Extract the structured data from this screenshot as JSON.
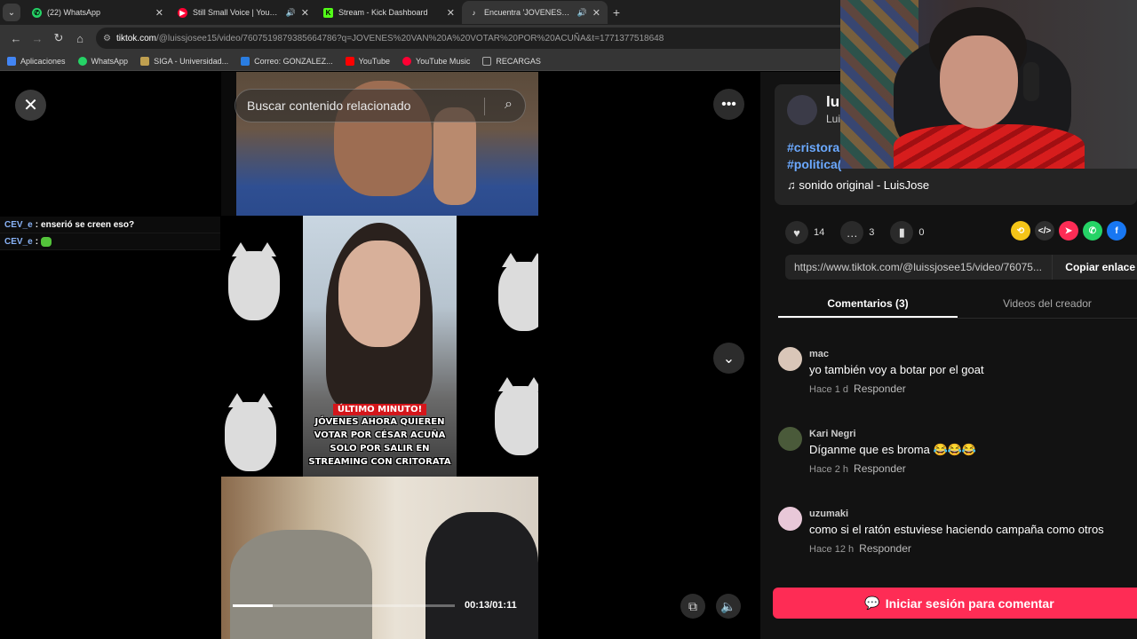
{
  "browser": {
    "tabs": [
      {
        "title": "(22) WhatsApp",
        "icon": "whatsapp-icon",
        "color": "#25d366",
        "audio": false
      },
      {
        "title": "Still Small Voice | YouTube M",
        "icon": "youtube-music-icon",
        "color": "#ff0033",
        "audio": true
      },
      {
        "title": "Stream - Kick Dashboard",
        "icon": "kick-icon",
        "color": "#53fc18",
        "audio": false
      },
      {
        "title": "Encuentra 'JOVENES VAN A",
        "icon": "tiktok-icon",
        "color": "#ffffff",
        "audio": true
      }
    ],
    "url_host": "tiktok.com",
    "url_rest": "/@luissjosee15/video/7607519879385664786?q=JOVENES%20VAN%20A%20VOTAR%20POR%20ACUÑA&t=1771377518648",
    "bookmarks": [
      {
        "label": "Aplicaciones",
        "icon": "apps-grid-icon",
        "color": "#4285f4"
      },
      {
        "label": "WhatsApp",
        "icon": "whatsapp-icon",
        "color": "#25d366"
      },
      {
        "label": "SIGA - Universidad...",
        "icon": "siga-icon",
        "color": "#c0a050"
      },
      {
        "label": "Correo: GONZALEZ...",
        "icon": "mail-icon",
        "color": "#2a7de1"
      },
      {
        "label": "YouTube",
        "icon": "youtube-icon",
        "color": "#ff0000"
      },
      {
        "label": "YouTube Music",
        "icon": "youtube-music-icon",
        "color": "#ff0033"
      },
      {
        "label": "RECARGAS",
        "icon": "folder-icon",
        "color": "#aaaaaa"
      }
    ]
  },
  "chat": [
    {
      "user": "CEV_e",
      "message": "enserió se creen eso?",
      "emote": false
    },
    {
      "user": "CEV_e",
      "message": "",
      "emote": true
    }
  ],
  "video": {
    "search_placeholder": "Buscar contenido relacionado",
    "headline_tag": "ÚLTIMO MINUTO!",
    "headline_body": "JÓVENES AHORA QUIEREN VOTAR POR CÉSAR ACUÑA SOLO POR SALIR EN STREAMING CON CRITORATA",
    "time": "00:13/01:11",
    "progress": 0.18
  },
  "creator": {
    "name": "lu",
    "handle": "Lui",
    "hashtags": [
      "#cristora",
      "#politica("
    ],
    "sound": "sonido original - LuisJose"
  },
  "actions": {
    "likes": "14",
    "comments": "3",
    "saves": "0"
  },
  "share": [
    {
      "icon": "repost-icon",
      "color": "#f5c518"
    },
    {
      "icon": "embed-icon",
      "color": "#2f2f2f"
    },
    {
      "icon": "send-icon",
      "color": "#fe2c55"
    },
    {
      "icon": "whatsapp-icon",
      "color": "#25d366"
    },
    {
      "icon": "facebook-icon",
      "color": "#1877f2"
    }
  ],
  "link": {
    "url": "https://www.tiktok.com/@luissjosee15/video/76075...",
    "copy_label": "Copiar enlace"
  },
  "panel_tabs": {
    "comments": "Comentarios (3)",
    "creator_videos": "Videos del creador"
  },
  "comments": [
    {
      "user": "mac",
      "text": "yo también voy a botar por el goat",
      "time": "Hace 1 d",
      "reply": "Responder",
      "avatar_color": "#d9c6b8"
    },
    {
      "user": "Kari Negri",
      "text": "Díganme que es broma 😂😂😂",
      "time": "Hace 2 h",
      "reply": "Responder",
      "avatar_color": "#4a5a3a"
    },
    {
      "user": "uzumaki",
      "text": "como si el ratón estuviese haciendo campaña como otros",
      "time": "Hace 12 h",
      "reply": "Responder",
      "avatar_color": "#e8c8d8"
    }
  ],
  "login_label": "Iniciar sesión para comentar",
  "colors": {
    "accent": "#fe2c55",
    "link": "#6ba9ff"
  }
}
